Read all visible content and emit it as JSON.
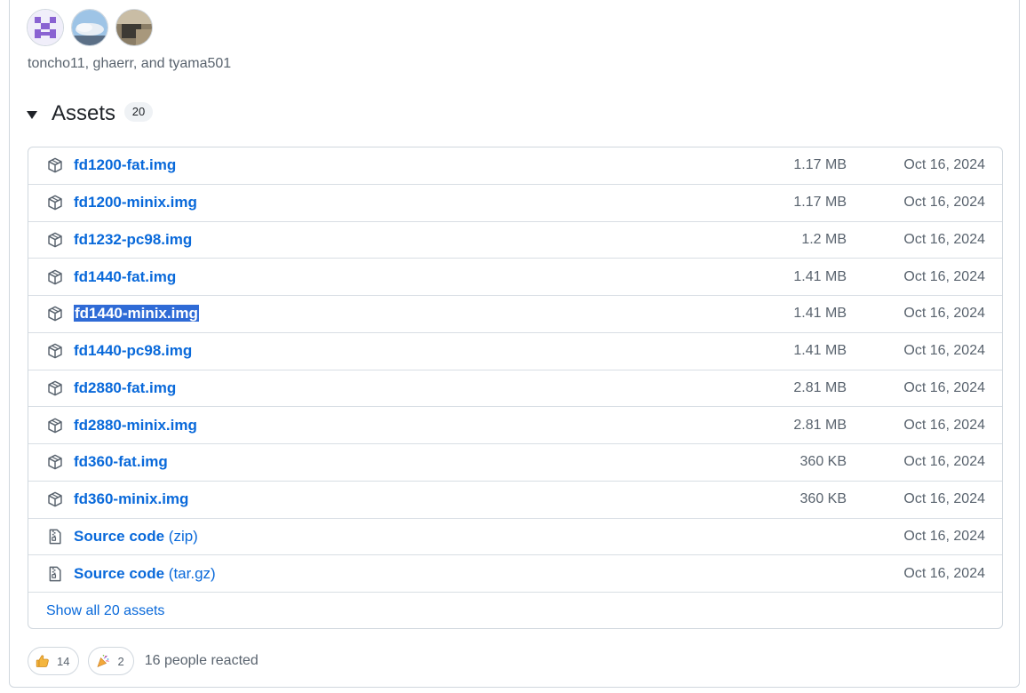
{
  "contributors": {
    "avatars": [
      "avatar-toncho11",
      "avatar-ghaerr",
      "avatar-tyama501"
    ],
    "text": "toncho11, ghaerr, and tyama501"
  },
  "assets": {
    "title": "Assets",
    "count": "20",
    "items": [
      {
        "icon": "package-icon",
        "name": "fd1200-fat.img",
        "suffix": "",
        "size": "1.17 MB",
        "date": "Oct 16, 2024"
      },
      {
        "icon": "package-icon",
        "name": "fd1200-minix.img",
        "suffix": "",
        "size": "1.17 MB",
        "date": "Oct 16, 2024"
      },
      {
        "icon": "package-icon",
        "name": "fd1232-pc98.img",
        "suffix": "",
        "size": "1.2 MB",
        "date": "Oct 16, 2024"
      },
      {
        "icon": "package-icon",
        "name": "fd1440-fat.img",
        "suffix": "",
        "size": "1.41 MB",
        "date": "Oct 16, 2024"
      },
      {
        "icon": "package-icon",
        "name": "fd1440-minix.img",
        "suffix": "",
        "size": "1.41 MB",
        "date": "Oct 16, 2024",
        "selected": true
      },
      {
        "icon": "package-icon",
        "name": "fd1440-pc98.img",
        "suffix": "",
        "size": "1.41 MB",
        "date": "Oct 16, 2024"
      },
      {
        "icon": "package-icon",
        "name": "fd2880-fat.img",
        "suffix": "",
        "size": "2.81 MB",
        "date": "Oct 16, 2024"
      },
      {
        "icon": "package-icon",
        "name": "fd2880-minix.img",
        "suffix": "",
        "size": "2.81 MB",
        "date": "Oct 16, 2024"
      },
      {
        "icon": "package-icon",
        "name": "fd360-fat.img",
        "suffix": "",
        "size": "360 KB",
        "date": "Oct 16, 2024"
      },
      {
        "icon": "package-icon",
        "name": "fd360-minix.img",
        "suffix": "",
        "size": "360 KB",
        "date": "Oct 16, 2024"
      },
      {
        "icon": "file-zip-icon",
        "name": "Source code",
        "suffix": "(zip)",
        "size": "",
        "date": "Oct 16, 2024"
      },
      {
        "icon": "file-zip-icon",
        "name": "Source code",
        "suffix": "(tar.gz)",
        "size": "",
        "date": "Oct 16, 2024"
      }
    ],
    "show_all_label": "Show all 20 assets"
  },
  "reactions": {
    "items": [
      {
        "icon": "thumbs-up-icon",
        "count": "14"
      },
      {
        "icon": "tada-icon",
        "count": "2"
      }
    ],
    "summary": "16 people reacted"
  },
  "colors": {
    "link": "#0969da",
    "muted": "#59636e",
    "border": "#d0d7de",
    "selection": "#2f6bd6"
  }
}
